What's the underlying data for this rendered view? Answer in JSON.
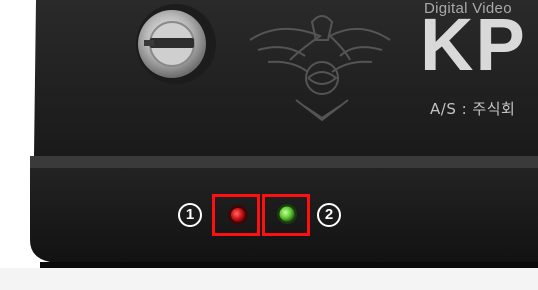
{
  "brand": {
    "tagline": "Digital Video",
    "logo_text": "KP",
    "service_text": "A/S : 주식회"
  },
  "indicators": [
    {
      "callout": "①",
      "led_color": "red"
    },
    {
      "callout": "②",
      "led_color": "green"
    }
  ],
  "colors": {
    "highlight_box": "#ff1010",
    "led_red": "#e01818",
    "led_green": "#6ed13a",
    "device_body": "#151515"
  },
  "icons": {
    "lock": "key-lock-icon",
    "emblem": "police-eagle-emblem-icon"
  }
}
